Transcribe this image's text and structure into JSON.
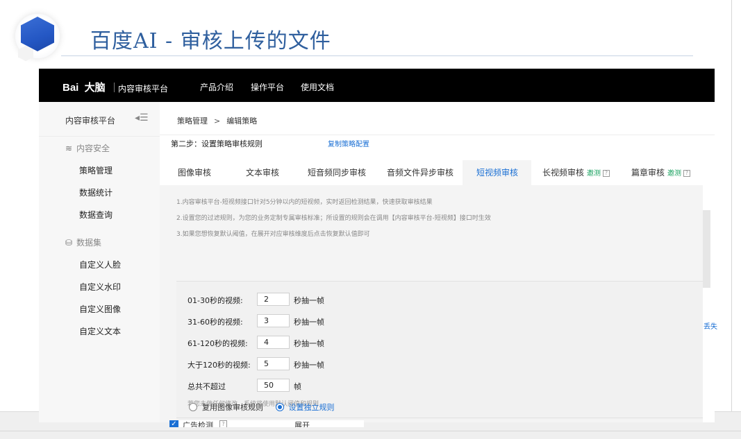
{
  "slide": {
    "title": "百度AI - 审核上传的文件"
  },
  "topnav": {
    "brand": "Bai  大脑",
    "brand_sub": "内容审核平台",
    "items": [
      "产品介绍",
      "操作平台",
      "使用文档"
    ]
  },
  "sidebar": {
    "title": "内容审核平台",
    "groups": [
      {
        "label": "内容安全",
        "items": [
          "策略管理",
          "数据统计",
          "数据查询"
        ]
      },
      {
        "label": "数据集",
        "items": [
          "自定义人脸",
          "自定义水印",
          "自定义图像",
          "自定义文本"
        ]
      }
    ]
  },
  "breadcrumb": {
    "parent": "策略管理",
    "sep": ">",
    "current": "编辑策略"
  },
  "step": {
    "title": "第二步：设置策略审核规则",
    "copy_link": "复制策略配置"
  },
  "tabs": [
    {
      "label": "图像审核"
    },
    {
      "label": "文本审核"
    },
    {
      "label": "短音频同步审核"
    },
    {
      "label": "音频文件异步审核"
    },
    {
      "label": "短视频审核",
      "active": true
    },
    {
      "label": "长视频审核",
      "badge": "邀测",
      "help": "?"
    },
    {
      "label": "篇章审核",
      "badge": "邀测",
      "help": "?"
    }
  ],
  "notes": [
    "1.内容审核平台-短视频接口针对5分钟以内的短视频，实时返回检测结果，快速获取审核结果",
    "2.设置您的过滤规则，为您的业务定制专属审核标准；所设置的规则会在调用【内容审核平台-短视频】接口时生效",
    "3.如果您想恢复默认阈值，在展开对应审核维度后点击恢复默认值即可"
  ],
  "frames": {
    "rows": [
      {
        "label": "01-30秒的视频:",
        "value": "2",
        "unit": "秒抽一帧"
      },
      {
        "label": "31-60秒的视频:",
        "value": "3",
        "unit": "秒抽一帧"
      },
      {
        "label": "61-120秒的视频:",
        "value": "4",
        "unit": "秒抽一帧"
      },
      {
        "label": "大于120秒的视频:",
        "value": "5",
        "unit": "秒抽一帧"
      }
    ],
    "total_label": "总共不超过",
    "total_value": "50",
    "total_unit": "帧",
    "hint": "若您未做任何修改，系统将使用默认阈值和规则"
  },
  "radios": [
    {
      "label": "复用图像审核规则",
      "checked": false
    },
    {
      "label": "设置独立规则",
      "checked": true
    }
  ],
  "bottom_row": {
    "check": "✓",
    "label": "广告检测",
    "help": "?",
    "expand": "展开"
  },
  "clipped_right_text": "丢失",
  "colors": {
    "accent": "#1a6fd4",
    "badge": "#19a15f",
    "nav_bg": "#000000",
    "title": "#2f5f9e"
  }
}
